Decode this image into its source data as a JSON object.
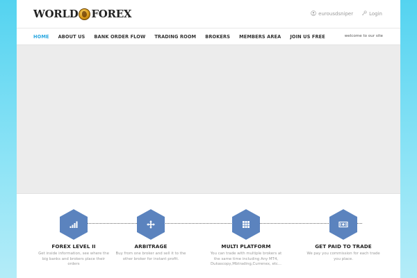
{
  "brand": {
    "logo_left": "WORLD",
    "logo_right": "FOREX"
  },
  "top_links": {
    "user_label": "eurousdsniper",
    "user_icon": "user-icon",
    "login_label": "Login",
    "login_icon": "key-icon"
  },
  "nav": {
    "items": [
      {
        "label": "HOME",
        "active": true
      },
      {
        "label": "ABOUT US",
        "active": false
      },
      {
        "label": "BANK ORDER FLOW",
        "active": false
      },
      {
        "label": "TRADING ROOM",
        "active": false
      },
      {
        "label": "BROKERS",
        "active": false
      },
      {
        "label": "MEMBERS AREA",
        "active": false
      },
      {
        "label": "JOIN US FREE",
        "active": false
      }
    ],
    "welcome": "welcome to our site"
  },
  "features": [
    {
      "title": "FOREX LEVEL II",
      "desc": "Get inside information, see where the big banks and brokers place their orders",
      "icon": "bar-chart-icon"
    },
    {
      "title": "ARBITRAGE",
      "desc": "Buy from one broker and sell it to the other broker for instant profit.",
      "icon": "move-arrows-icon"
    },
    {
      "title": "MULTI PLATFORM",
      "desc": "You can trade with multiple brokers at the same time including Any MT4, Dukascopy,Mbtrading,Currenex, etc...",
      "icon": "grid-icon"
    },
    {
      "title": "GET PAID TO TRADE",
      "desc": "We pay you commission for each trade you place.",
      "icon": "banknote-icon"
    }
  ],
  "colors": {
    "accent": "#2aa7e0",
    "hex_fill": "#5b83be",
    "background": "#54d3f0"
  }
}
